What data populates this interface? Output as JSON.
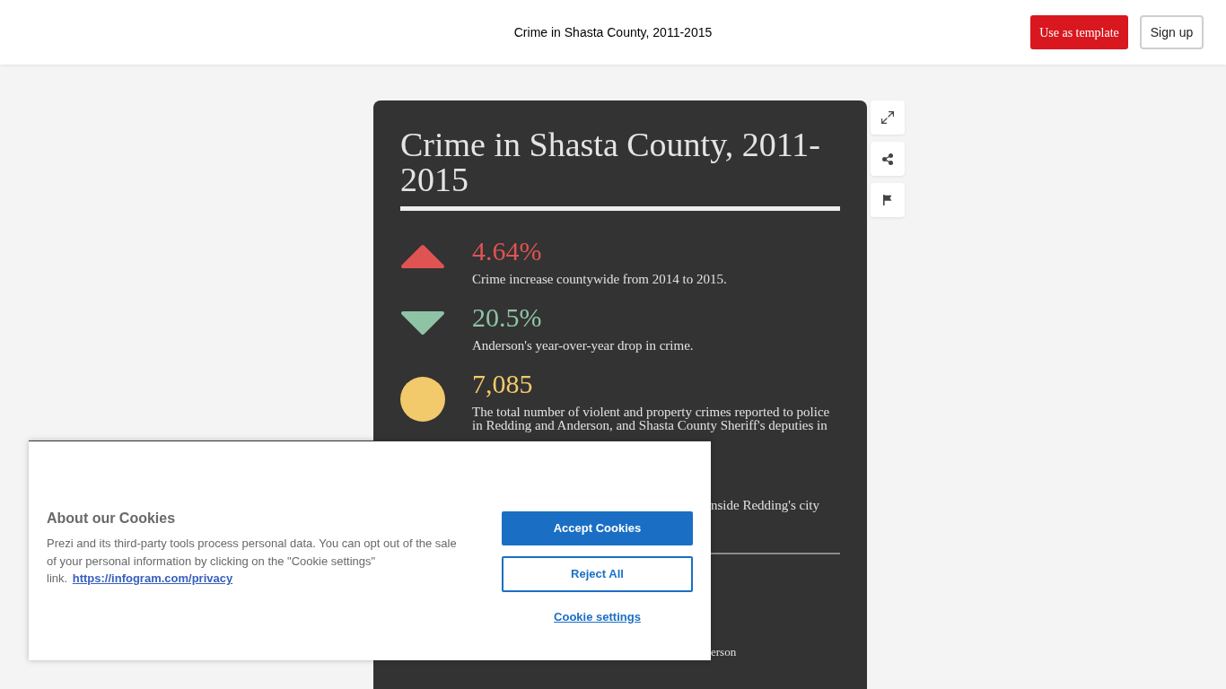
{
  "header": {
    "title": "Crime in Shasta County, 2011-2015",
    "buttons": [
      {
        "label": "Use as template",
        "kind": "primary"
      },
      {
        "label": "Sign up",
        "kind": "secondary"
      }
    ]
  },
  "infographic": {
    "title": "Crime in Shasta County, 2011-2015",
    "stats": [
      {
        "kind": "increase",
        "value": "4.64%",
        "description": "Crime increase countywide from 2014 to 2015.",
        "color": "#e05353"
      },
      {
        "kind": "decrease",
        "value": "20.5%",
        "description": "Anderson's year-over-year drop in crime.",
        "color": "#8ec3a6"
      },
      {
        "kind": "total",
        "value": "7,085",
        "description": "The total number of violent and property crimes reported to police in Redding and Anderson, and Shasta County Sheriff's deputies in",
        "color": "#f2c96b"
      }
    ],
    "covered_stat": {
      "description": "nside Redding's city"
    },
    "covered_section": {
      "label": "erson"
    }
  },
  "cookie_banner": {
    "title": "About our Cookies",
    "text": "Prezi and its third-party tools process personal data. You can opt out of the sale of your personal information by clicking on the \"Cookie settings\" link.",
    "link": "https://infogram.com/privacy",
    "buttons": [
      {
        "label": "Accept Cookies",
        "kind": "primary"
      },
      {
        "label": "Reject All",
        "kind": "outline"
      },
      {
        "label": "Cookie settings",
        "kind": "link"
      }
    ]
  }
}
